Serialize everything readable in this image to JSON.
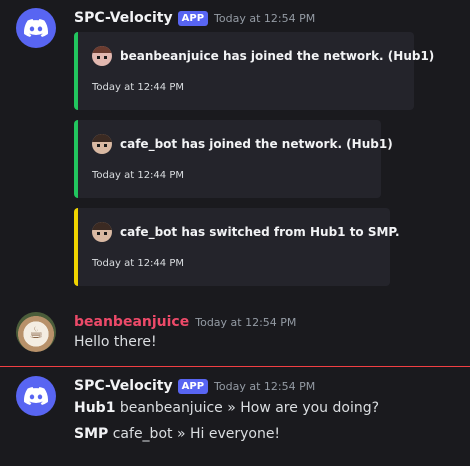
{
  "colors": {
    "accent": "#5865f2",
    "embed_green": "#22c55e",
    "embed_yellow": "#f0d400",
    "user_name": "#ed4a69",
    "new_divider": "#f23f43"
  },
  "messages": [
    {
      "author": "SPC-Velocity",
      "badge": "APP",
      "timestamp": "Today at 12:54 PM",
      "avatar_icon": "discord-logo-icon",
      "embeds": [
        {
          "text": "beanbeanjuice has joined the network. (Hub1)",
          "time": "Today at 12:44 PM",
          "color": "green"
        },
        {
          "text": "cafe_bot has joined the network. (Hub1)",
          "time": "Today at 12:44 PM",
          "color": "green"
        },
        {
          "text": "cafe_bot has switched from Hub1 to SMP.",
          "time": "Today at 12:44 PM",
          "color": "yellow"
        }
      ]
    },
    {
      "author": "beanbeanjuice",
      "timestamp": "Today at 12:54 PM",
      "avatar_icon": "coffee-cup-avatar",
      "content": "Hello there!"
    },
    {
      "author": "SPC-Velocity",
      "badge": "APP",
      "timestamp": "Today at 12:54 PM",
      "avatar_icon": "discord-logo-icon",
      "lines": [
        {
          "server": "Hub1",
          "text": "beanbeanjuice » How are you doing?"
        },
        {
          "server": "SMP",
          "text": "cafe_bot » Hi everyone!"
        }
      ]
    }
  ]
}
